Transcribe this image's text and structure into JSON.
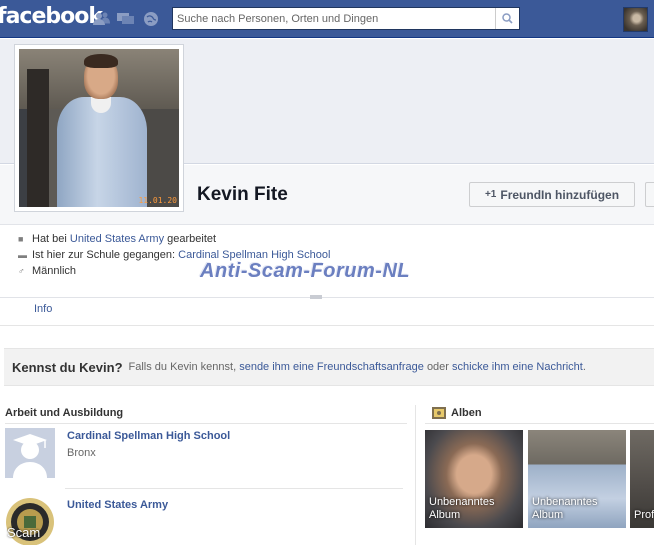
{
  "header": {
    "logo": "facebook",
    "search_placeholder": "Suche nach Personen, Orten und Dingen",
    "icons": [
      "friends-icon",
      "messages-icon",
      "notifications-icon",
      "search-icon"
    ]
  },
  "profile": {
    "name": "Kevin Fite",
    "photo_timestamp": "11.01.20",
    "add_friend_label": "FreundIn hinzufügen"
  },
  "about": {
    "work_prefix": "Hat bei ",
    "work_link": "United States Army",
    "work_suffix": " gearbeitet",
    "school_prefix": "Ist hier zur Schule gegangen: ",
    "school_link": "Cardinal Spellman High School",
    "gender": "Männlich"
  },
  "watermark": "Anti-Scam-Forum-NL",
  "tabs": {
    "info": "Info"
  },
  "kennst": {
    "title": "Kennst du Kevin?",
    "text1": "Falls du Kevin kennst, ",
    "link1": "sende ihm eine Freundschaftsanfrage",
    "text2": " oder ",
    "link2": "schicke ihm eine Nachricht",
    "text3": "."
  },
  "work": {
    "title": "Arbeit und Ausbildung",
    "items": [
      {
        "name": "Cardinal Spellman High School",
        "sub": "Bronx"
      },
      {
        "name": "United States Army",
        "sub": ""
      }
    ],
    "stamp": "Scam"
  },
  "albums": {
    "title": "Alben",
    "items": [
      {
        "name": "Unbenanntes",
        "sub": "Album"
      },
      {
        "name": "Unbenanntes",
        "sub": "Album"
      },
      {
        "name": "Prof",
        "sub": ""
      }
    ]
  },
  "colors": {
    "brand": "#3b5998",
    "link": "#3b5998",
    "watermark": "#6b7fc0"
  }
}
